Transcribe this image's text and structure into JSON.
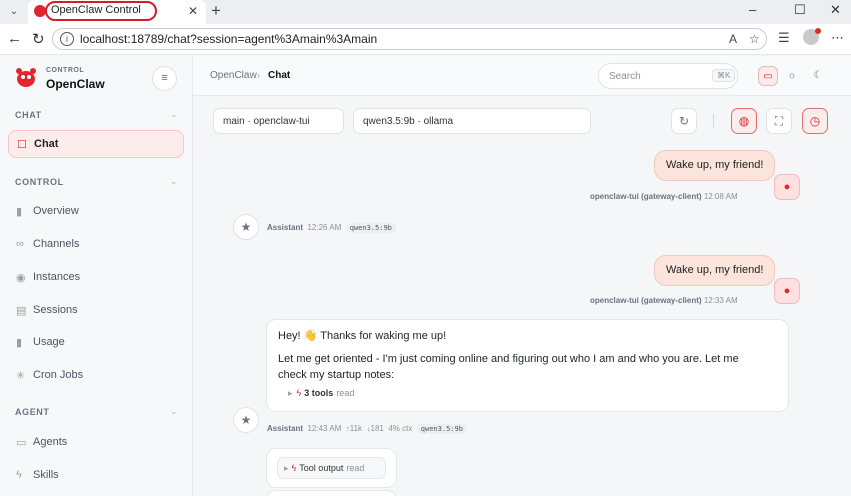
{
  "browser": {
    "tab_title": "OpenClaw Control",
    "tab_close": "✕",
    "new_tab": "+",
    "url": "localhost:18789/chat?session=agent%3Amain%3Amain",
    "window_controls": {
      "minimize": "–",
      "maximize": "☐",
      "close": "✕"
    },
    "icons": {
      "back": "←",
      "reload": "↻",
      "read_aloud": "A",
      "favorite": "☆",
      "collections": "☰",
      "more": "⋯"
    }
  },
  "sidebar": {
    "brand_sub": "CONTROL",
    "brand_title": "OpenClaw",
    "collapse_icon": "≡",
    "sections": [
      {
        "title": "CHAT",
        "items": [
          {
            "icon": "chat-icon",
            "glyph": "☐",
            "label": "Chat",
            "active": true
          }
        ]
      },
      {
        "title": "CONTROL",
        "items": [
          {
            "icon": "bar-chart-icon",
            "glyph": "▮",
            "label": "Overview"
          },
          {
            "icon": "link-icon",
            "glyph": "∞",
            "label": "Channels"
          },
          {
            "icon": "radio-icon",
            "glyph": "◉",
            "label": "Instances"
          },
          {
            "icon": "file-icon",
            "glyph": "▤",
            "label": "Sessions"
          },
          {
            "icon": "bar-chart-icon",
            "glyph": "▮",
            "label": "Usage"
          },
          {
            "icon": "loader-icon",
            "glyph": "✳",
            "label": "Cron Jobs"
          }
        ]
      },
      {
        "title": "AGENT",
        "items": [
          {
            "icon": "folder-icon",
            "glyph": "▭",
            "label": "Agents"
          },
          {
            "icon": "zap-icon",
            "glyph": "ϟ",
            "label": "Skills"
          }
        ]
      }
    ],
    "section_chevron": "⌄"
  },
  "topbar": {
    "breadcrumb_root": "OpenClaw",
    "breadcrumb_sep": "›",
    "breadcrumb_current": "Chat",
    "search_placeholder": "Search",
    "search_shortcut": "⌘K",
    "theme": {
      "system": "▭",
      "light": "☼",
      "dark": "☾"
    }
  },
  "chat_toolbar": {
    "session_select": "main · openclaw-tui",
    "model_select": "qwen3.5:9b · ollama",
    "refresh_icon": "↻",
    "brain_icon": "◍",
    "focus_icon": "⛶",
    "history_icon": "◷"
  },
  "messages": [
    {
      "role": "user",
      "text": "Wake up, my friend!",
      "sender": "openclaw-tui (gateway-client)",
      "time": "12:08 AM"
    },
    {
      "role": "assistant",
      "name": "Assistant",
      "time": "12:26 AM",
      "model": "qwen3.5:9b"
    },
    {
      "role": "user",
      "text": "Wake up, my friend!",
      "sender": "openclaw-tui (gateway-client)",
      "time": "12:33 AM"
    },
    {
      "role": "assistant",
      "line1": "Hey! 👋 Thanks for waking me up!",
      "line2": "Let me get oriented - I'm just coming online and figuring out who I am and who you are. Let me check my startup notes:",
      "tools_count": "3 tools",
      "tools_sub": "read",
      "name": "Assistant",
      "time": "12:43 AM",
      "tokens_in": "↑11k",
      "tokens_out": "↓181",
      "ctx": "4% ctx",
      "model": "qwen3.5:9b"
    },
    {
      "role": "tool",
      "label": "Tool output",
      "sub": "read"
    }
  ],
  "colors": {
    "accent": "#e0242c",
    "user_bubble": "#fbe4dc"
  }
}
